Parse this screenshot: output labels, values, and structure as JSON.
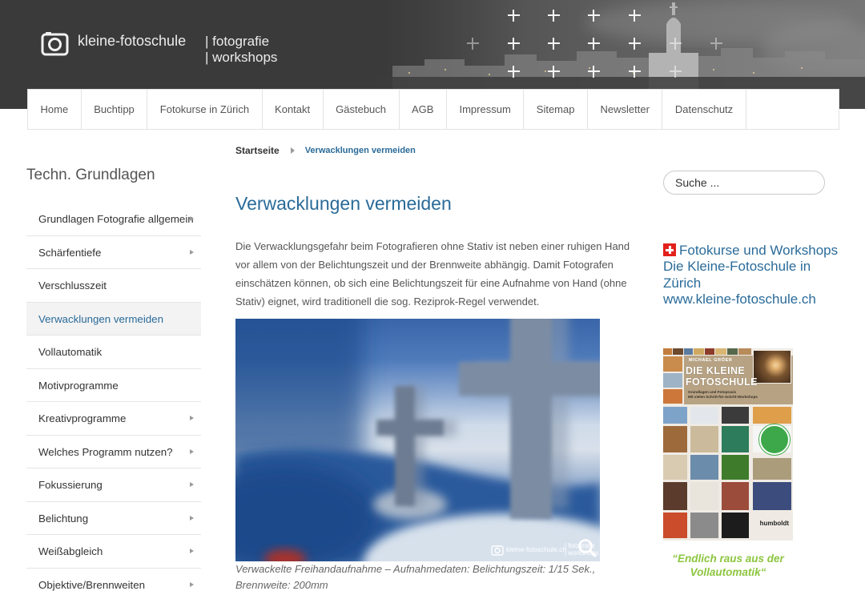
{
  "site": {
    "logo_name": "kleine-fotoschule",
    "logo_tagline_1": "| fotografie",
    "logo_tagline_2": "| workshops"
  },
  "nav": {
    "items": [
      {
        "label": "Home"
      },
      {
        "label": "Buchtipp"
      },
      {
        "label": "Fotokurse in Zürich"
      },
      {
        "label": "Kontakt"
      },
      {
        "label": "Gästebuch"
      },
      {
        "label": "AGB"
      },
      {
        "label": "Impressum"
      },
      {
        "label": "Sitemap"
      },
      {
        "label": "Newsletter"
      },
      {
        "label": "Datenschutz"
      }
    ]
  },
  "breadcrumb": {
    "home": "Startseite",
    "current": "Verwacklungen vermeiden"
  },
  "sidebar": {
    "title": "Techn. Grundlagen",
    "items": [
      {
        "label": "Grundlagen Fotografie allgemein",
        "has_submenu": true,
        "active": false
      },
      {
        "label": "Schärfentiefe",
        "has_submenu": true,
        "active": false
      },
      {
        "label": "Verschlusszeit",
        "has_submenu": false,
        "active": false
      },
      {
        "label": "Verwacklungen vermeiden",
        "has_submenu": false,
        "active": true
      },
      {
        "label": "Vollautomatik",
        "has_submenu": false,
        "active": false
      },
      {
        "label": "Motivprogramme",
        "has_submenu": false,
        "active": false
      },
      {
        "label": "Kreativprogramme",
        "has_submenu": true,
        "active": false
      },
      {
        "label": "Welches Programm nutzen?",
        "has_submenu": true,
        "active": false
      },
      {
        "label": "Fokussierung",
        "has_submenu": true,
        "active": false
      },
      {
        "label": "Belichtung",
        "has_submenu": true,
        "active": false
      },
      {
        "label": "Weißabgleich",
        "has_submenu": true,
        "active": false
      },
      {
        "label": "Objektive/Brennweiten",
        "has_submenu": true,
        "active": false
      }
    ]
  },
  "article": {
    "title": "Verwacklungen vermeiden",
    "intro_lines": [
      "Die Verwacklungsgefahr beim Fotografieren ohne Stativ ist neben einer ruhigen Hand",
      "vor allem von der Belichtungszeit und der Brennweite abhängig. Damit Fotografen",
      "einschätzen können, ob sich eine Belichtungszeit für eine Aufnahme von Hand (ohne",
      "Stativ) eignet, wird traditionell die sog. Reziprok-Regel verwendet."
    ],
    "photo": {
      "watermark_site": "kleine-fotoschule.ch",
      "watermark_tagline_1": "| fotografie",
      "watermark_tagline_2": "| workshops"
    },
    "caption_lines": [
      "Verwackelte Freihandaufnahme – Aufnahmedaten: Belichtungszeit: 1/15 Sek.,",
      "Brennweite: 200mm"
    ]
  },
  "search": {
    "placeholder": "Suche ..."
  },
  "promo": {
    "lines": [
      "Fotokurse und Workshops",
      "Die Kleine-Fotoschule in",
      "Zürich",
      "www.kleine-fotoschule.ch"
    ]
  },
  "book": {
    "author": "MICHAEL GRÖER",
    "title_line_1": "DIE KLEINE",
    "title_line_2": "FOTOSCHULE",
    "subtitle_1": "Grundlagen und Fotopraxis",
    "subtitle_2": "Mit vielen Schritt-für-Schritt-Workshops",
    "publisher": "humboldt",
    "quote_line_1": "“Endlich raus aus der",
    "quote_line_2": "Vollautomatik“"
  },
  "colors": {
    "header_bg": "#3a3a3a",
    "link_blue": "#2a6b99",
    "quote_green": "#8cc63f",
    "active_item_bg": "#f3f3f3",
    "swiss_red": "#e3211c"
  },
  "icons": {
    "logo": "camera-icon",
    "breadcrumb_separator": "chevron-right-icon",
    "submenu": "chevron-right-icon",
    "photo_zoom": "zoom-icon",
    "promo_flag": "swiss-flag-icon"
  }
}
